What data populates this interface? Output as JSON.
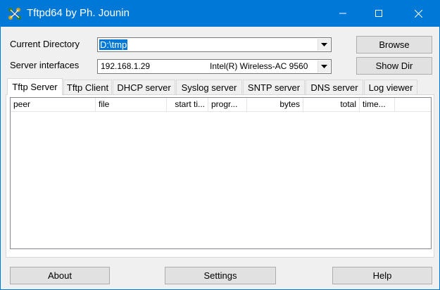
{
  "window": {
    "title": "Tftpd64 by Ph. Jounin",
    "icon": "tftpd-app-icon"
  },
  "form": {
    "current_directory_label": "Current Directory",
    "current_directory_value": "D:\\tmp",
    "server_interfaces_label": "Server interfaces",
    "server_interface_ip": "192.168.1.29",
    "server_interface_adapter": "Intel(R) Wireless-AC 9560"
  },
  "buttons": {
    "browse": "Browse",
    "show_dir": "Show Dir",
    "about": "About",
    "settings": "Settings",
    "help": "Help"
  },
  "tabs": [
    {
      "label": "Tftp Server",
      "active": true
    },
    {
      "label": "Tftp Client"
    },
    {
      "label": "DHCP server"
    },
    {
      "label": "Syslog server"
    },
    {
      "label": "SNTP server"
    },
    {
      "label": "DNS server"
    },
    {
      "label": "Log viewer"
    }
  ],
  "table": {
    "columns": [
      "peer",
      "file",
      "start ti...",
      "progr...",
      "bytes",
      "total",
      "time..."
    ],
    "rows": []
  },
  "colors": {
    "titlebar": "#0078d7",
    "selection": "#0078d7"
  }
}
